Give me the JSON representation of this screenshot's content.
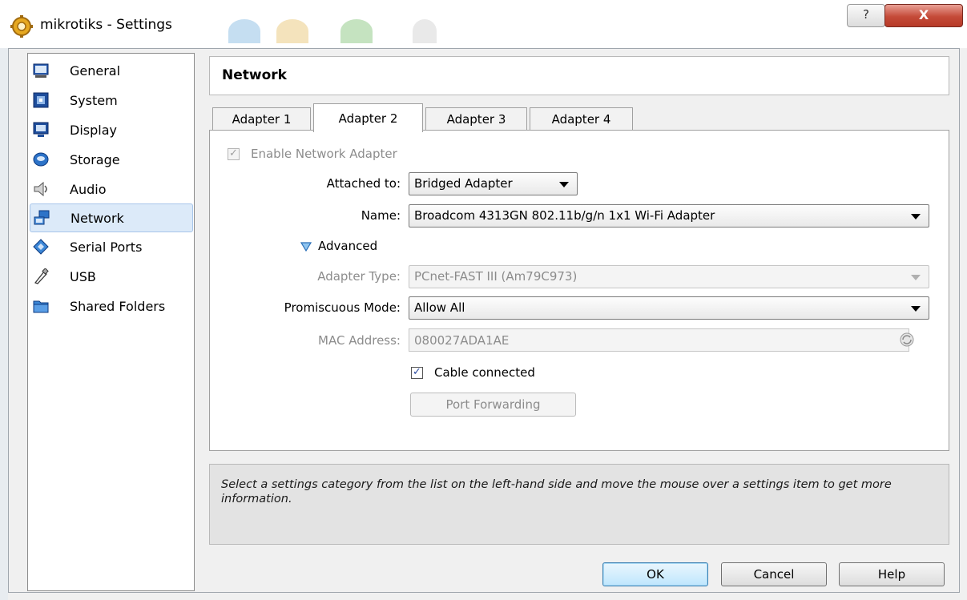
{
  "window": {
    "title": "mikrotiks - Settings",
    "help_button": "?",
    "close_button": "X"
  },
  "sidebar": {
    "items": [
      {
        "label": "General",
        "icon": "general-icon"
      },
      {
        "label": "System",
        "icon": "system-icon"
      },
      {
        "label": "Display",
        "icon": "display-icon"
      },
      {
        "label": "Storage",
        "icon": "storage-icon"
      },
      {
        "label": "Audio",
        "icon": "audio-icon"
      },
      {
        "label": "Network",
        "icon": "network-icon",
        "selected": true
      },
      {
        "label": "Serial Ports",
        "icon": "serial-ports-icon"
      },
      {
        "label": "USB",
        "icon": "usb-icon"
      },
      {
        "label": "Shared Folders",
        "icon": "shared-folders-icon"
      }
    ]
  },
  "page": {
    "title": "Network"
  },
  "tabs": [
    {
      "label": "Adapter 1"
    },
    {
      "label": "Adapter 2",
      "active": true
    },
    {
      "label": "Adapter 3"
    },
    {
      "label": "Adapter 4"
    }
  ],
  "form": {
    "enable_label": "Enable Network Adapter",
    "enable_checked": true,
    "attached_label": "Attached to:",
    "attached_value": "Bridged Adapter",
    "name_label": "Name:",
    "name_value": "Broadcom 4313GN 802.11b/g/n 1x1 Wi-Fi Adapter",
    "advanced_label": "Advanced",
    "adapter_type_label": "Adapter Type:",
    "adapter_type_value": "PCnet-FAST III (Am79C973)",
    "promiscuous_label": "Promiscuous Mode:",
    "promiscuous_value": "Allow All",
    "mac_label": "MAC Address:",
    "mac_value": "080027ADA1AE",
    "cable_label": "Cable connected",
    "cable_checked": true,
    "port_forwarding_label": "Port Forwarding"
  },
  "info": {
    "text": "Select a settings category from the list on the left-hand side and move the mouse over a settings item to get more information."
  },
  "buttons": {
    "ok": "OK",
    "cancel": "Cancel",
    "help": "Help"
  },
  "colors": {
    "selection_bg": "#dceaf9",
    "close_red": "#c44a38",
    "ok_blue": "#bee6fd"
  }
}
